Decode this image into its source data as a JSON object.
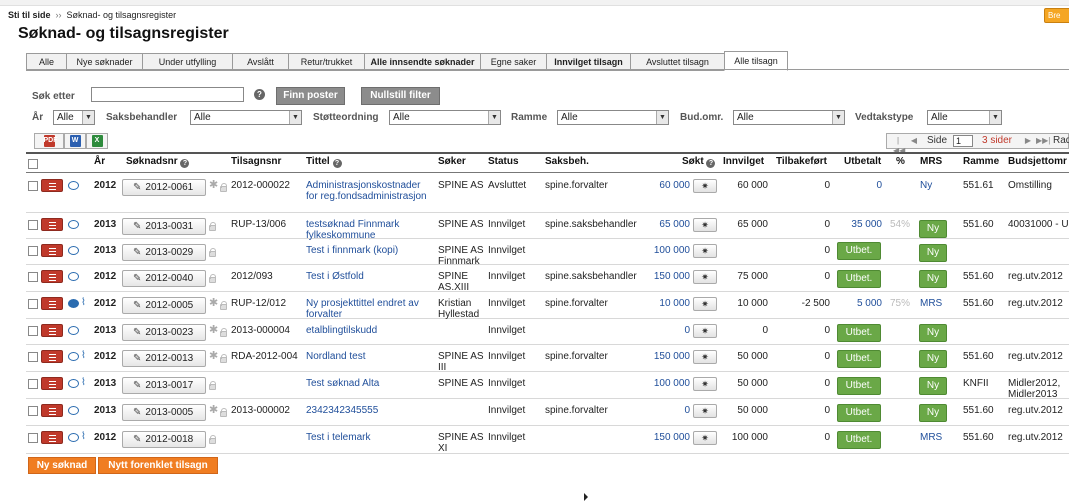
{
  "breadcrumb": {
    "home": "Sti til side",
    "sep": "››",
    "current": "Søknad- og tilsagnsregister"
  },
  "top_right_button": "Bre",
  "page_title": "Søknad- og tilsagnsregister",
  "tabs": [
    {
      "label": "Alle",
      "bold": false,
      "active": false
    },
    {
      "label": "Nye søknader",
      "bold": false,
      "active": false
    },
    {
      "label": "Under utfylling",
      "bold": false,
      "active": false
    },
    {
      "label": "Avslått",
      "bold": false,
      "active": false
    },
    {
      "label": "Retur/trukket",
      "bold": false,
      "active": false
    },
    {
      "label": "Alle innsendte søknader",
      "bold": true,
      "active": false
    },
    {
      "label": "Egne saker",
      "bold": false,
      "active": false
    },
    {
      "label": "Innvilget tilsagn",
      "bold": true,
      "active": false
    },
    {
      "label": "Avsluttet tilsagn",
      "bold": false,
      "active": false
    },
    {
      "label": "Alle tilsagn",
      "bold": false,
      "active": true
    }
  ],
  "search": {
    "label": "Søk etter",
    "value": "",
    "help": "?",
    "find_button": "Finn poster",
    "reset_button": "Nullstill filter"
  },
  "filters": {
    "year": {
      "label": "År",
      "value": "Alle"
    },
    "caseworker": {
      "label": "Saksbehandler",
      "value": "Alle"
    },
    "support": {
      "label": "Støtteordning",
      "value": "Alle"
    },
    "frame": {
      "label": "Ramme",
      "value": "Alle"
    },
    "budget_area": {
      "label": "Bud.omr.",
      "value": "Alle"
    },
    "decision_type": {
      "label": "Vedtakstype",
      "value": "Alle"
    }
  },
  "export": {
    "pdf": "PDF",
    "word": "W",
    "excel": "X"
  },
  "pager": {
    "first": "|◀◀",
    "prev": "◀",
    "page_label": "Side",
    "page": "1",
    "pages": "3 sider",
    "next": "▶",
    "last": "▶▶|",
    "rad": "Rad"
  },
  "columns": {
    "year": "År",
    "nr": "Søknadsnr",
    "tilsagn": "Tilsagnsnr",
    "title": "Tittel",
    "applicant": "Søker",
    "status": "Status",
    "caseworker": "Saksbeh.",
    "applied": "Søkt",
    "granted": "Innvilget",
    "returned": "Tilbakeført",
    "paid": "Utbetalt",
    "pct": "%",
    "mrs": "MRS",
    "frame": "Ramme",
    "budget": "Budsjettomr"
  },
  "rows": [
    {
      "year": "2012",
      "nr": "2012-0061",
      "tilsagn": "2012-000022",
      "title": "Administrasjonskostnader for reg.fondsadministrasjon",
      "applicant": "SPINE AS",
      "status": "Avsluttet",
      "caseworker": "spine.forvalter",
      "applied": "60 000",
      "granted": "60 000",
      "returned": "0",
      "paid": "0",
      "pct": "",
      "mrs": "Ny",
      "mrs_button": false,
      "utbet": false,
      "frame": "551.61",
      "budget": "Omstilling"
    },
    {
      "year": "2013",
      "nr": "2013-0031",
      "tilsagn": "RUP-13/006",
      "title": "testsøknad Finnmark fylkeskommune",
      "applicant": "SPINE AS",
      "status": "Innvilget",
      "caseworker": "spine.saksbehandler",
      "applied": "65 000",
      "granted": "65 000",
      "returned": "0",
      "paid": "35 000",
      "pct": "54%",
      "mrs": "Ny",
      "mrs_button": true,
      "utbet": false,
      "frame": "551.60",
      "budget": "40031000 - U"
    },
    {
      "year": "2013",
      "nr": "2013-0029",
      "tilsagn": "",
      "title": "Test i finnmark (kopi)",
      "applicant": "SPINE AS Finnmark",
      "status": "Innvilget",
      "caseworker": "",
      "applied": "100 000",
      "granted": "",
      "returned": "0",
      "paid": "Utbet.",
      "pct": "",
      "mrs": "Ny",
      "mrs_button": true,
      "utbet": true,
      "frame": "",
      "budget": ""
    },
    {
      "year": "2012",
      "nr": "2012-0040",
      "tilsagn": "2012/093",
      "title": "Test i Østfold",
      "applicant": "SPINE AS.XIII",
      "status": "Innvilget",
      "caseworker": "spine.saksbehandler",
      "applied": "150 000",
      "granted": "75 000",
      "returned": "0",
      "paid": "Utbet.",
      "pct": "",
      "mrs": "Ny",
      "mrs_button": true,
      "utbet": true,
      "frame": "551.60",
      "budget": "reg.utv.2012"
    },
    {
      "year": "2012",
      "nr": "2012-0005",
      "tilsagn": "RUP-12/012",
      "title": "Ny prosjekttittel endret av forvalter",
      "applicant": "Kristian Hyllestad",
      "status": "Innvilget",
      "caseworker": "spine.forvalter",
      "applied": "10 000",
      "granted": "10 000",
      "returned": "-2 500",
      "paid": "5 000",
      "pct": "75%",
      "mrs": "MRS",
      "mrs_button": false,
      "utbet": false,
      "frame": "551.60",
      "budget": "reg.utv.2012"
    },
    {
      "year": "2013",
      "nr": "2013-0023",
      "tilsagn": "2013-000004",
      "title": "etalblingtilskudd",
      "applicant": "",
      "status": "Innvilget",
      "caseworker": "",
      "applied": "0",
      "granted": "0",
      "returned": "0",
      "paid": "Utbet.",
      "pct": "",
      "mrs": "Ny",
      "mrs_button": true,
      "utbet": true,
      "frame": "",
      "budget": ""
    },
    {
      "year": "2012",
      "nr": "2012-0013",
      "tilsagn": "RDA-2012-004",
      "title": "Nordland test",
      "applicant": "SPINE AS III",
      "status": "Innvilget",
      "caseworker": "spine.forvalter",
      "applied": "150 000",
      "granted": "50 000",
      "returned": "0",
      "paid": "Utbet.",
      "pct": "",
      "mrs": "Ny",
      "mrs_button": true,
      "utbet": true,
      "frame": "551.60",
      "budget": "reg.utv.2012"
    },
    {
      "year": "2013",
      "nr": "2013-0017",
      "tilsagn": "",
      "title": "Test søknad Alta",
      "applicant": "SPINE AS",
      "status": "Innvilget",
      "caseworker": "",
      "applied": "100 000",
      "granted": "50 000",
      "returned": "0",
      "paid": "Utbet.",
      "pct": "",
      "mrs": "Ny",
      "mrs_button": true,
      "utbet": true,
      "frame": "KNFII",
      "budget": "Midler2012, Midler2013"
    },
    {
      "year": "2013",
      "nr": "2013-0005",
      "tilsagn": "2013-000002",
      "title": "2342342345555",
      "applicant": "",
      "status": "Innvilget",
      "caseworker": "spine.forvalter",
      "applied": "0",
      "granted": "50 000",
      "returned": "0",
      "paid": "Utbet.",
      "pct": "",
      "mrs": "Ny",
      "mrs_button": true,
      "utbet": true,
      "frame": "551.60",
      "budget": "reg.utv.2012"
    },
    {
      "year": "2012",
      "nr": "2012-0018",
      "tilsagn": "",
      "title": "Test i telemark",
      "applicant": "SPINE AS XI",
      "status": "Innvilget",
      "caseworker": "",
      "applied": "150 000",
      "granted": "100 000",
      "returned": "0",
      "paid": "Utbet.",
      "pct": "",
      "mrs": "MRS",
      "mrs_button": false,
      "utbet": true,
      "frame": "551.60",
      "budget": "reg.utv.2012"
    }
  ],
  "bottom_buttons": {
    "new_application": "Ny søknad",
    "new_simple": "Nytt forenklet tilsagn"
  },
  "colors": {
    "accent_red": "#c0392b",
    "green": "#6aa847",
    "orange": "#f07d22",
    "link": "#1f4e9a"
  }
}
